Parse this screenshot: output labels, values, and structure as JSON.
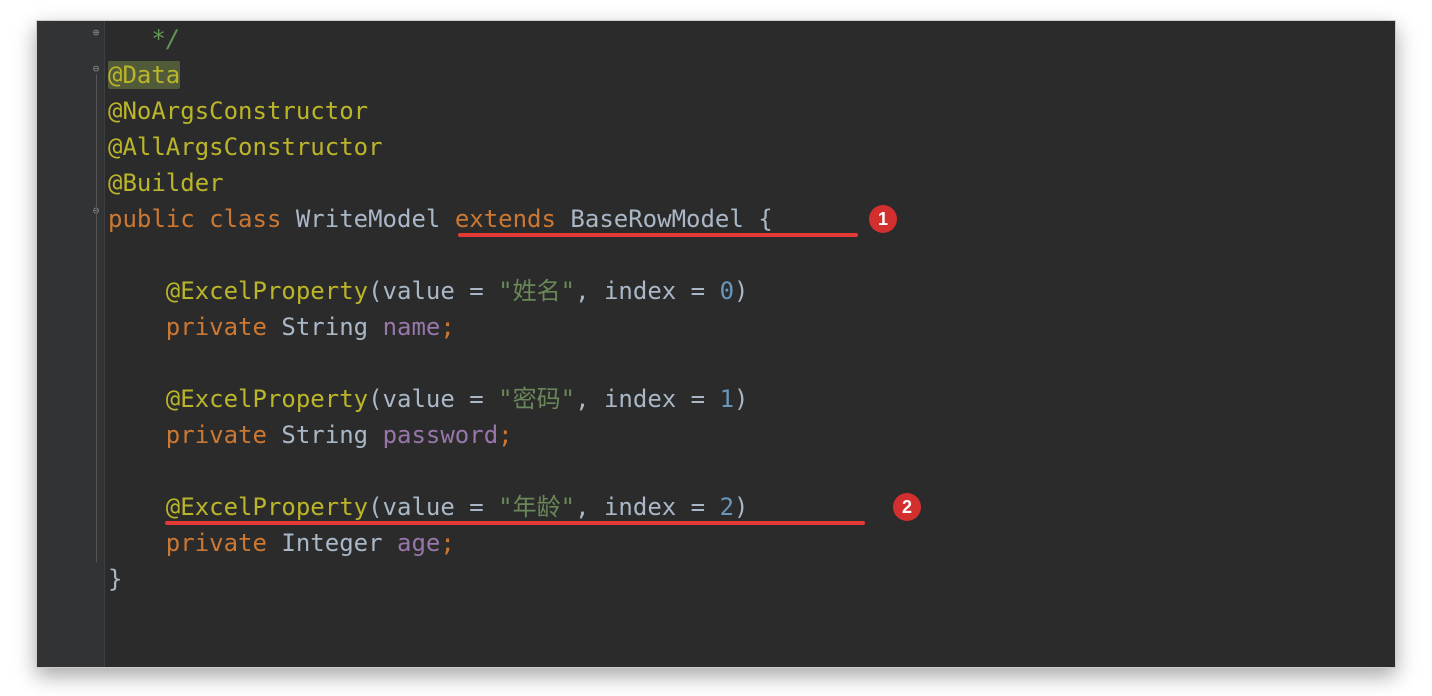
{
  "code": {
    "commentTail": "*/",
    "ann_data": "@Data",
    "ann_noargs": "@NoArgsConstructor",
    "ann_allargs": "@AllArgsConstructor",
    "ann_builder": "@Builder",
    "kw_public": "public",
    "kw_class": "class",
    "class_name": "WriteModel",
    "kw_extends": "extends",
    "super_name": "BaseRowModel",
    "lbrace": " {",
    "ann_ep": "@ExcelProperty",
    "lp": "(",
    "rp": ")",
    "p_value": "value",
    "eq": " = ",
    "comma": ", ",
    "p_index": "index",
    "str_name": "\"姓名\"",
    "idx0": "0",
    "kw_private": "private",
    "ty_string": "String",
    "fld_name": "name",
    "semi": ";",
    "str_pwd": "\"密码\"",
    "idx1": "1",
    "fld_pwd": "password",
    "str_age": "\"年龄\"",
    "idx2": "2",
    "ty_integer": "Integer",
    "fld_age": "age",
    "rbrace": "}"
  },
  "badges": {
    "b1": "1",
    "b2": "2"
  }
}
